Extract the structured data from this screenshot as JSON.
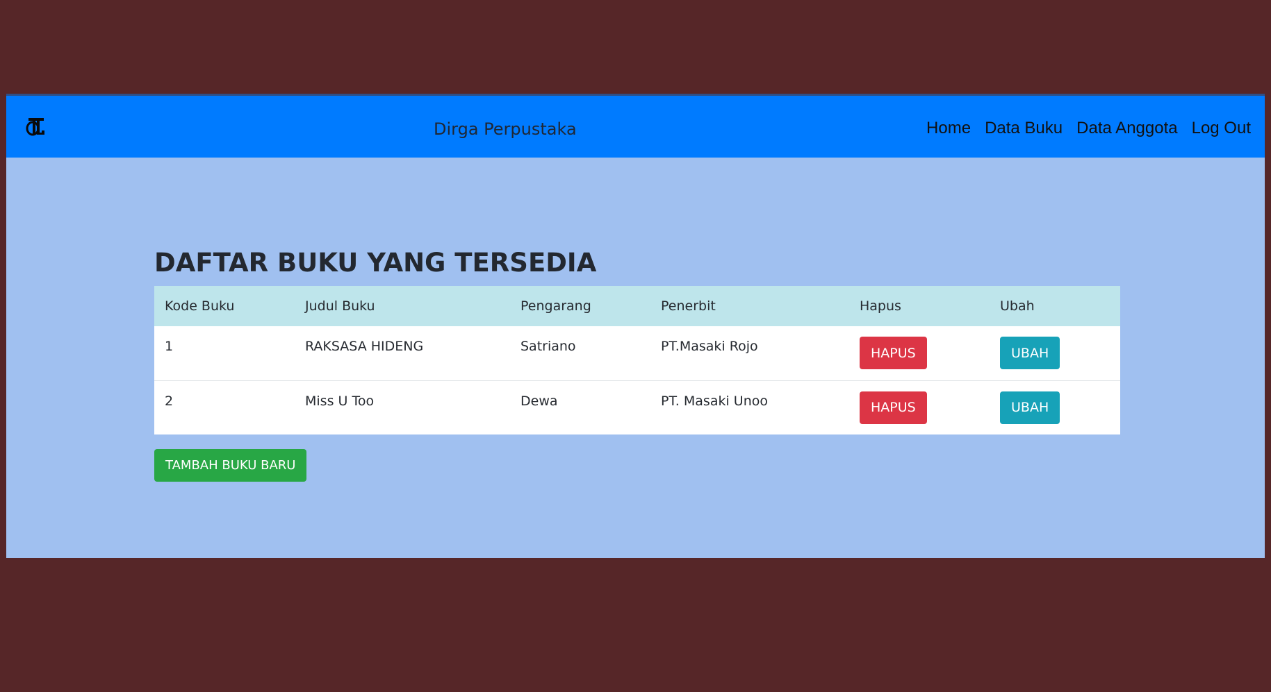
{
  "navbar": {
    "brand": "Dirga Perpustaka",
    "logo_icon": "library-logo-icon",
    "links": [
      "Home",
      "Data Buku",
      "Data Anggota",
      "Log Out"
    ]
  },
  "main": {
    "title": "DAFTAR BUKU YANG TERSEDIA",
    "table": {
      "headers": [
        "Kode Buku",
        "Judul Buku",
        "Pengarang",
        "Penerbit",
        "Hapus",
        "Ubah"
      ],
      "rows": [
        {
          "kode": "1",
          "judul": "RAKSASA HIDENG",
          "pengarang": "Satriano",
          "penerbit": "PT.Masaki Rojo",
          "hapus_label": "HAPUS",
          "ubah_label": "UBAH"
        },
        {
          "kode": "2",
          "judul": "Miss U Too",
          "pengarang": "Dewa",
          "penerbit": "PT. Masaki Unoo",
          "hapus_label": "HAPUS",
          "ubah_label": "UBAH"
        }
      ]
    },
    "add_button_label": "TAMBAH BUKU BARU"
  },
  "colors": {
    "outer_background": "#562628",
    "page_background": "#a0c0f0",
    "navbar": "#007bff",
    "table_header": "#bee5eb",
    "danger": "#dc3545",
    "info": "#17a2b8",
    "success": "#28a745"
  }
}
